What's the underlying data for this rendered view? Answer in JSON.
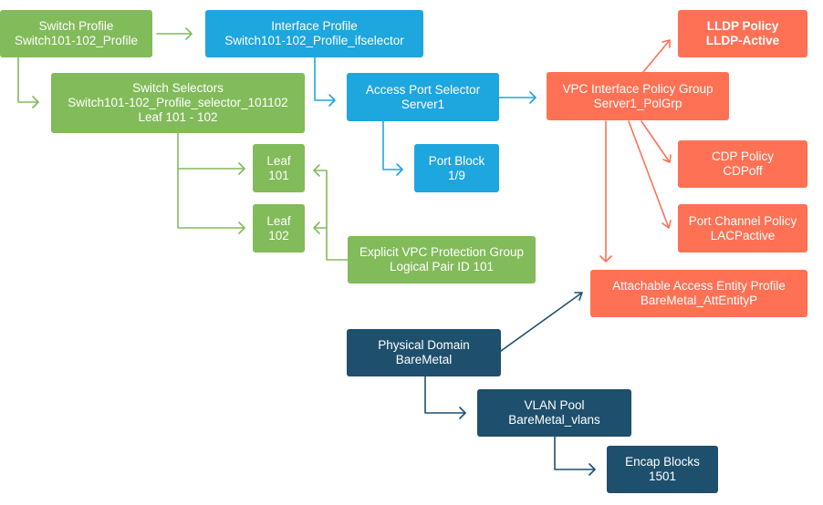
{
  "colors": {
    "green": "#82bb5a",
    "blue": "#1ea6de",
    "orange": "#fe7154",
    "dark": "#1e4f6d"
  },
  "nodes": {
    "switch_profile": {
      "title": "Switch Profile",
      "value": "Switch101-102_Profile"
    },
    "interface_profile": {
      "title": "Interface Profile",
      "value": "Switch101-102_Profile_ifselector"
    },
    "lldp_policy": {
      "title": "LLDP Policy",
      "value": "LLDP-Active"
    },
    "switch_selectors": {
      "title": "Switch Selectors",
      "value": "Switch101-102_Profile_selector_101102",
      "extra": "Leaf 101 - 102"
    },
    "access_port_selector": {
      "title": "Access Port Selector",
      "value": "Server1"
    },
    "vpc_policy_group": {
      "title": "VPC Interface Policy Group",
      "value": "Server1_PolGrp"
    },
    "leaf_101": {
      "title": "Leaf",
      "value": "101"
    },
    "leaf_102": {
      "title": "Leaf",
      "value": "102"
    },
    "port_block": {
      "title": "Port Block",
      "value": "1/9"
    },
    "cdp_policy": {
      "title": "CDP Policy",
      "value": "CDPoff"
    },
    "port_channel_policy": {
      "title": "Port Channel Policy",
      "value": "LACPactive"
    },
    "vpc_protection_group": {
      "title": "Explicit VPC Protection Group",
      "value": "Logical Pair ID 101"
    },
    "aaep": {
      "title": "Attachable Access Entity Profile",
      "value": "BareMetal_AttEntityP"
    },
    "physical_domain": {
      "title": "Physical Domain",
      "value": "BareMetal"
    },
    "vlan_pool": {
      "title": "VLAN Pool",
      "value": "BareMetal_vlans"
    },
    "encap_blocks": {
      "title": "Encap Blocks",
      "value": "1501"
    }
  },
  "edges": [
    {
      "from": "switch_profile",
      "to": "interface_profile",
      "color": "green"
    },
    {
      "from": "switch_profile",
      "to": "switch_selectors",
      "color": "green"
    },
    {
      "from": "switch_selectors",
      "to": "leaf_101",
      "color": "green"
    },
    {
      "from": "switch_selectors",
      "to": "leaf_102",
      "color": "green"
    },
    {
      "from": "vpc_protection_group",
      "to": "leaf_101",
      "color": "green"
    },
    {
      "from": "vpc_protection_group",
      "to": "leaf_102",
      "color": "green"
    },
    {
      "from": "interface_profile",
      "to": "access_port_selector",
      "color": "blue"
    },
    {
      "from": "access_port_selector",
      "to": "port_block",
      "color": "blue"
    },
    {
      "from": "access_port_selector",
      "to": "vpc_policy_group",
      "color": "blue"
    },
    {
      "from": "vpc_policy_group",
      "to": "lldp_policy",
      "color": "orange"
    },
    {
      "from": "vpc_policy_group",
      "to": "cdp_policy",
      "color": "orange"
    },
    {
      "from": "vpc_policy_group",
      "to": "port_channel_policy",
      "color": "orange"
    },
    {
      "from": "vpc_policy_group",
      "to": "aaep",
      "color": "orange"
    },
    {
      "from": "physical_domain",
      "to": "aaep",
      "color": "dark"
    },
    {
      "from": "physical_domain",
      "to": "vlan_pool",
      "color": "dark"
    },
    {
      "from": "vlan_pool",
      "to": "encap_blocks",
      "color": "dark"
    }
  ]
}
